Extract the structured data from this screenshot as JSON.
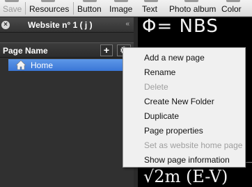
{
  "toolbar": {
    "items": [
      {
        "label": "Save",
        "disabled": true
      },
      {
        "label": "Resources"
      },
      {
        "label": "Button"
      },
      {
        "label": "Image"
      },
      {
        "label": "Text"
      },
      {
        "label": "Photo album"
      },
      {
        "label": "Color"
      }
    ]
  },
  "panel": {
    "title": "Website n° 1 ( j )",
    "column_header": "Page Name",
    "add_button": "+",
    "tree": [
      {
        "label": "Home",
        "selected": true
      }
    ]
  },
  "context_menu": {
    "items": [
      {
        "label": "Add a new page",
        "enabled": true
      },
      {
        "label": "Rename",
        "enabled": true
      },
      {
        "label": "Delete",
        "enabled": false
      },
      {
        "label": "Create New Folder",
        "enabled": true
      },
      {
        "label": "Duplicate",
        "enabled": true
      },
      {
        "label": "Page properties",
        "enabled": true
      },
      {
        "label": "Set as website home page",
        "enabled": false
      },
      {
        "label": "Show page information",
        "enabled": true
      }
    ]
  },
  "preview": {
    "top_text": "Φ= NBS",
    "bottom_text": "√2m  (E-V)"
  },
  "colors": {
    "selection": "#3a76d6",
    "panel_bg": "#303030",
    "menu_bg": "#f0f0f0",
    "disabled_text": "#9e9e9e"
  }
}
